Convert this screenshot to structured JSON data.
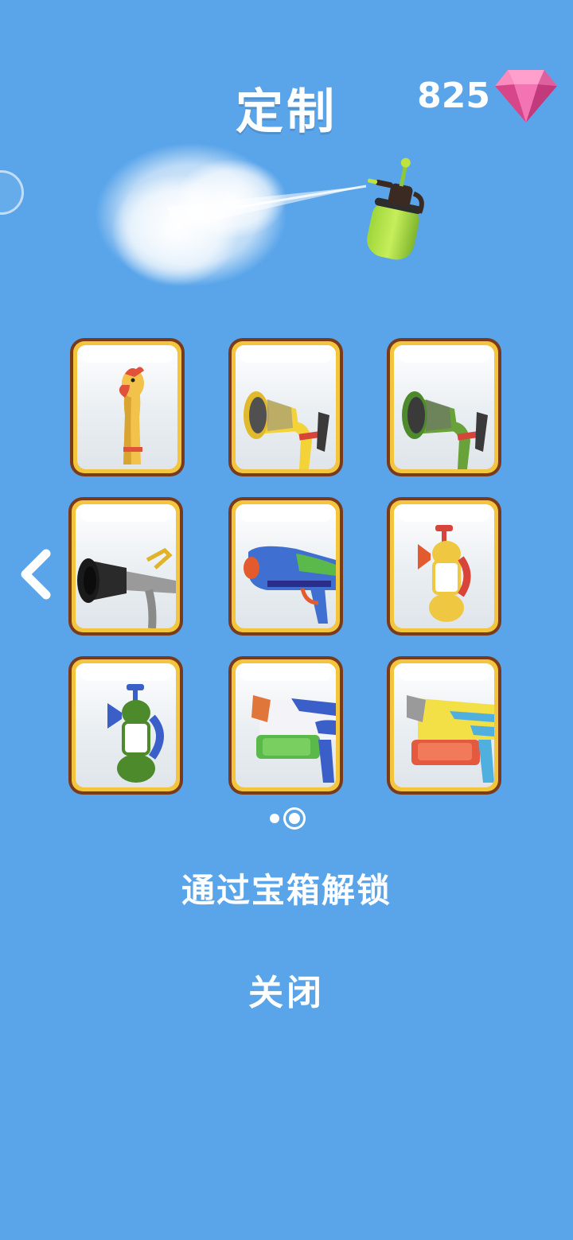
{
  "header": {
    "title": "定制",
    "gems": "825"
  },
  "colors": {
    "background": "#5aa5ea",
    "card_border": "#7a3a1c",
    "card_frame": "#f2c53d",
    "gem": "#f06aa8"
  },
  "grid": {
    "items": [
      {
        "name": "rubber-chicken",
        "icon": "rubber-chicken-icon"
      },
      {
        "name": "yellow-hose-nozzle",
        "icon": "hose-nozzle-icon"
      },
      {
        "name": "green-hose-nozzle",
        "icon": "hose-nozzle-icon"
      },
      {
        "name": "black-fire-hose",
        "icon": "fire-hose-icon"
      },
      {
        "name": "blue-water-gun",
        "icon": "water-gun-icon"
      },
      {
        "name": "yellow-pressure-sprayer",
        "icon": "pressure-sprayer-icon"
      },
      {
        "name": "green-pressure-sprayer",
        "icon": "pressure-sprayer-icon"
      },
      {
        "name": "white-blaster",
        "icon": "water-blaster-icon"
      },
      {
        "name": "yellow-blaster",
        "icon": "water-blaster-icon"
      }
    ]
  },
  "pager": {
    "pages": 2,
    "current": 2
  },
  "actions": {
    "unlock_label": "通过宝箱解锁",
    "close_label": "关闭"
  }
}
